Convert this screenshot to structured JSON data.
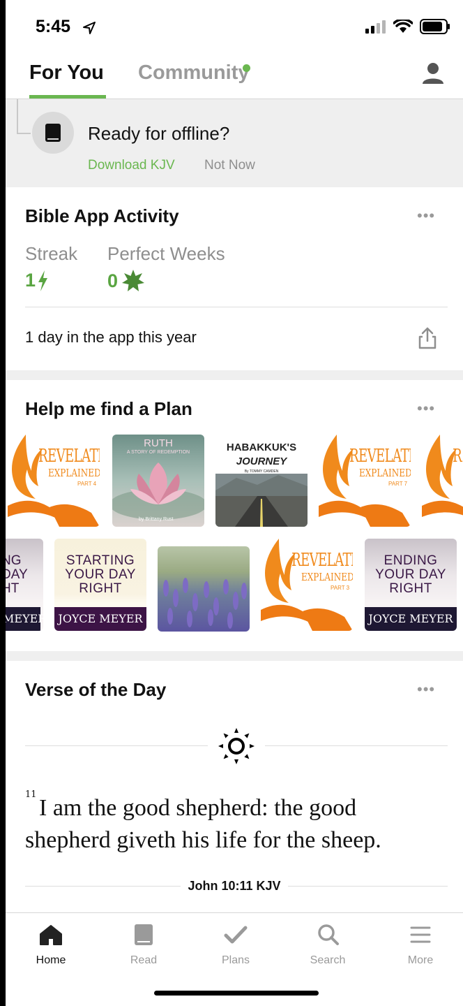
{
  "status_bar": {
    "time": "5:45",
    "location_icon": "location-arrow-icon",
    "signal_icon": "signal-icon",
    "wifi_icon": "wifi-icon",
    "battery_icon": "battery-icon"
  },
  "header": {
    "tabs": [
      {
        "label": "For You",
        "active": true
      },
      {
        "label": "Community",
        "active": false
      }
    ],
    "profile_icon": "person-icon"
  },
  "offline_banner": {
    "icon": "book-icon",
    "title": "Ready for offline?",
    "primary_action": "Download KJV",
    "secondary_action": "Not Now"
  },
  "activity": {
    "title": "Bible App Activity",
    "more_icon": "more-dots-icon",
    "streak": {
      "label": "Streak",
      "value": "1",
      "icon": "lightning-icon"
    },
    "perfect_weeks": {
      "label": "Perfect Weeks",
      "value": "0",
      "icon": "starburst-icon"
    },
    "days_text": "1 day in the app this year",
    "share_icon": "share-icon"
  },
  "plans": {
    "title": "Help me find a Plan",
    "row1": [
      {
        "title": "REVELATION",
        "subtitle": "EXPLAINED",
        "part": "PART 4"
      },
      {
        "title": "RUTH",
        "subtitle": "A STORY OF REDEMPTION",
        "byline": "by Brittany Rust"
      },
      {
        "title": "HABAKKUK'S",
        "subtitle": "JOURNEY",
        "byline": "By TOMMY CAMDEN"
      },
      {
        "title": "REVELATION",
        "subtitle": "EXPLAINED",
        "part": "PART 7"
      },
      {
        "title": "R"
      }
    ],
    "row2": [
      {
        "line1": "NG",
        "line2": "DAY",
        "line3": "HT",
        "author": "MEYER"
      },
      {
        "line1": "STARTING",
        "line2": "YOUR DAY",
        "line3": "RIGHT",
        "author": "JOYCE MEYER"
      },
      {
        "image": "lavender-field"
      },
      {
        "title": "REVELATION",
        "subtitle": "EXPLAINED",
        "part": "PART 3"
      },
      {
        "line1": "ENDING",
        "line2": "YOUR DAY",
        "line3": "RIGHT",
        "author": "JOYCE MEYER"
      }
    ]
  },
  "verse_of_day": {
    "title": "Verse of the Day",
    "sun_icon": "sun-icon",
    "verse_number": "11",
    "verse_text": "I am the good shepherd: the good shepherd giveth his life for the sheep.",
    "reference": "John 10:11 KJV"
  },
  "bottom_nav": [
    {
      "label": "Home",
      "icon": "home-icon",
      "active": true
    },
    {
      "label": "Read",
      "icon": "book-icon",
      "active": false
    },
    {
      "label": "Plans",
      "icon": "check-icon",
      "active": false
    },
    {
      "label": "Search",
      "icon": "search-icon",
      "active": false
    },
    {
      "label": "More",
      "icon": "menu-icon",
      "active": false
    }
  ],
  "colors": {
    "accent": "#6ab750",
    "stat_green": "#5aa542",
    "grey_text": "#8e8e8e",
    "section_bg": "#efefef",
    "revelation_orange": "#f08a1c",
    "joyce_purple": "#3d1446"
  }
}
